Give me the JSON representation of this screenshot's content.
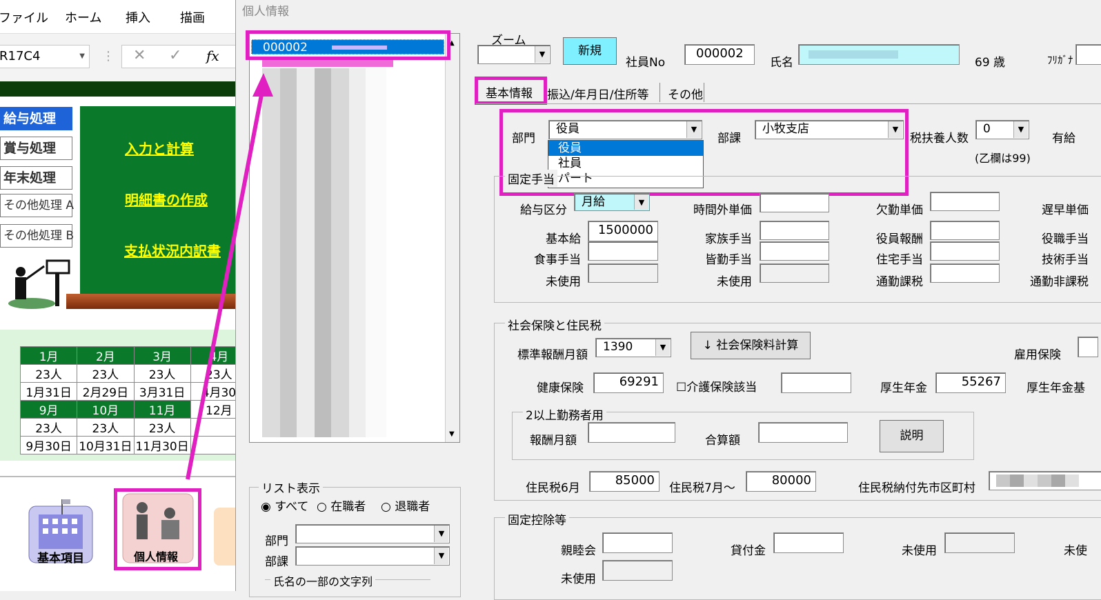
{
  "excel": {
    "menu": [
      "ファイル",
      "ホーム",
      "挿入",
      "描画"
    ],
    "cell_ref": "R17C4",
    "fx": "fx",
    "side_buttons": [
      "給与処理",
      "賞与処理",
      "年末処理",
      "その他処理 A",
      "その他処理 B"
    ],
    "links": [
      "入力と計算",
      "明細書の作成",
      "支払状況内訳書"
    ],
    "calendar": {
      "row1_months": [
        "1月",
        "2月",
        "3月",
        "4月"
      ],
      "row1_people": [
        "23人",
        "23人",
        "23人",
        "23人"
      ],
      "row1_dates": [
        "1月31日",
        "2月29日",
        "3月31日",
        "4月30"
      ],
      "row2_months": [
        "9月",
        "10月",
        "11月",
        "12月"
      ],
      "row2_people": [
        "23人",
        "23人",
        "23人",
        ""
      ],
      "row2_dates": [
        "9月30日",
        "10月31日",
        "11月30日",
        ""
      ]
    },
    "bottom_icons": [
      "基本項目",
      "個人情報"
    ]
  },
  "dialog": {
    "title": "個人情報",
    "list_selected": "000002",
    "zoom_label": "ズーム",
    "new_button": "新規",
    "emp_no_label": "社員No",
    "emp_no": "000002",
    "name_label": "氏名",
    "age": "69",
    "age_unit": "歳",
    "furigana_label": "ﾌﾘｶﾞﾅ",
    "tabs": [
      "基本情報",
      "振込/年月日/住所等",
      "その他"
    ],
    "dept_label": "部門",
    "dept_value": "役員",
    "dept_options": [
      "役員",
      "社員",
      "パート"
    ],
    "section_label": "部課",
    "section_value": "小牧支店",
    "dependents_label": "税扶養人数",
    "dependents_value": "0",
    "dependents_note": "(乙欄は99)",
    "paid_leave_label": "有給",
    "fixed_allow_title": "固定手当",
    "pay_type_label": "給与区分",
    "pay_type_value": "月給",
    "overtime_label": "時間外単価",
    "absence_label": "欠勤単価",
    "late_label": "遅早単価",
    "base_label": "基本給",
    "base_value": "1500000",
    "family_label": "家族手当",
    "exec_pay_label": "役員報酬",
    "post_label": "役職手当",
    "meal_label": "食事手当",
    "attend_label": "皆勤手当",
    "housing_label": "住宅手当",
    "tech_label": "技術手当",
    "unused1_label": "未使用",
    "unused2_label": "未使用",
    "commute_tax_label": "通勤課税",
    "commute_nontax_label": "通勤非課税",
    "social_title": "社会保険と住民税",
    "std_monthly_label": "標準報酬月額",
    "std_monthly_value": "1390",
    "calc_button": "↓ 社会保険料計算",
    "employment_ins_label": "雇用保険",
    "health_label": "健康保険",
    "health_value": "69291",
    "care_label": "介護保険該当",
    "pension_label": "厚生年金",
    "pension_value": "55267",
    "pension_fund_label": "厚生年金基",
    "multi_title": "2以上勤務者用",
    "rem_month_label": "報酬月額",
    "total_label": "合算額",
    "explain_button": "説明",
    "res_tax6_label": "住民税6月",
    "res_tax6_value": "85000",
    "res_tax7_label": "住民税7月～",
    "res_tax7_value": "80000",
    "res_city_label": "住民税納付先市区町村",
    "deduct_title": "固定控除等",
    "social_club_label": "親睦会",
    "loan_label": "貸付金",
    "unused3_label": "未使用",
    "unused4_label": "未使",
    "unused5_label": "未使用",
    "list_display_title": "リスト表示",
    "radio_all": "すべて",
    "radio_active": "在職者",
    "radio_retired": "退職者",
    "filter_dept_label": "部門",
    "filter_section_label": "部課",
    "name_part_label": "氏名の一部の文字列"
  },
  "colors": {
    "highlight": "#e020c0",
    "excel_green": "#0a7a2a",
    "selected": "#0078d7",
    "cyan": "#bff7fb"
  }
}
